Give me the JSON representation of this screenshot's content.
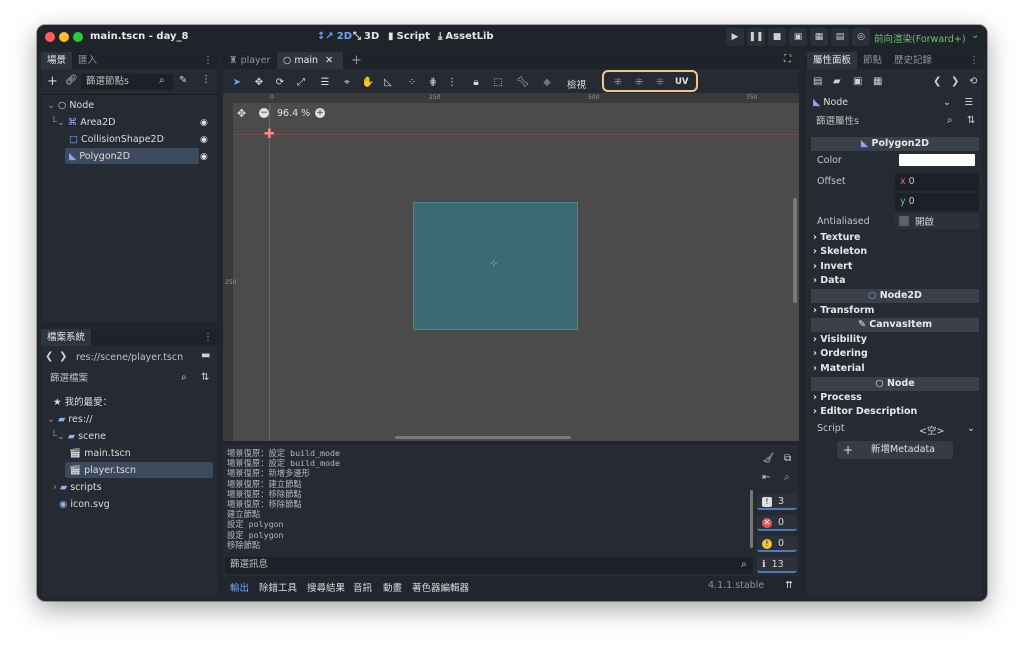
{
  "window": {
    "title": "main.tscn - day_8"
  },
  "topnav": {
    "btn2d": "2D",
    "btn3d": "3D",
    "script": "Script",
    "assetlib": "AssetLib",
    "icon2d": "↕↗",
    "icon3d": "⤡",
    "scriptIcon": "▮",
    "assetIcon": "⤓"
  },
  "renderer": "前向渲染(Forward+)",
  "scene": {
    "tabs": [
      "場景",
      "匯入"
    ],
    "filter_placeholder": "篩選節點s",
    "nodes": [
      {
        "label": "Node",
        "icon": "○"
      },
      {
        "label": "Area2D",
        "icon": "⌘"
      },
      {
        "label": "CollisionShape2D",
        "icon": "□"
      },
      {
        "label": "Polygon2D",
        "icon": "◣"
      }
    ],
    "eye": "◉"
  },
  "filesystem": {
    "tab": "檔案系統",
    "path": "res://scene/player.tscn",
    "filter_placeholder": "篩選檔案",
    "favorites": "我的最愛：",
    "items": [
      "res://",
      "scene",
      "main.tscn",
      "player.tscn",
      "scripts",
      "icon.svg"
    ]
  },
  "editor": {
    "tabs": [
      "player",
      "main"
    ],
    "close": "✕",
    "add": "+",
    "view_label": "檢視",
    "uv_label": "UV",
    "zoom": "96.4 %",
    "ruler": [
      "0",
      "250",
      "500",
      "750"
    ],
    "ruler_left": "250"
  },
  "output": {
    "lines": [
      "場景復原：設定 build_mode",
      "場景復原：設定 build_mode",
      "場景復原：新增多邊形",
      "場景復原：建立節點",
      "場景復原：移除節點",
      "場景復原：移除節點",
      "建立節點",
      "設定 polygon",
      "設定 polygon",
      "移除節點"
    ],
    "filter_placeholder": "篩選訊息",
    "counts": {
      "messages": "3",
      "errors": "0",
      "warnings": "0",
      "info": "13"
    },
    "bottom_tabs": [
      "輸出",
      "除錯工具",
      "搜尋結果",
      "音訊",
      "動畫",
      "著色器編輯器"
    ],
    "version": "4.1.1.stable"
  },
  "inspector": {
    "tabs": [
      "屬性面板",
      "節點",
      "歷史記錄"
    ],
    "node": "Node",
    "filter_placeholder": "篩選屬性s",
    "section_title": "Polygon2D",
    "color_label": "Color",
    "offset_label": "Offset",
    "offset_x_axis": "x",
    "offset_y_axis": "y",
    "offset_x": "0",
    "offset_y": "0",
    "antialiased_label": "Antialiased",
    "antialiased_value": "開啟",
    "groups1": [
      "Texture",
      "Skeleton",
      "Invert",
      "Data"
    ],
    "node2d": "Node2D",
    "transform": "Transform",
    "canvasitem": "CanvasItem",
    "groups2": [
      "Visibility",
      "Ordering",
      "Material"
    ],
    "groups3": [
      "Process",
      "Editor Description"
    ],
    "script_label": "Script",
    "script_value": "<空>",
    "add_meta": "新增Metadata"
  },
  "colors": {
    "accent": "#5a8fd8",
    "polygon": "#3b6a73",
    "highlight": "#f2c48b",
    "viewport": "#4b4b4b"
  }
}
